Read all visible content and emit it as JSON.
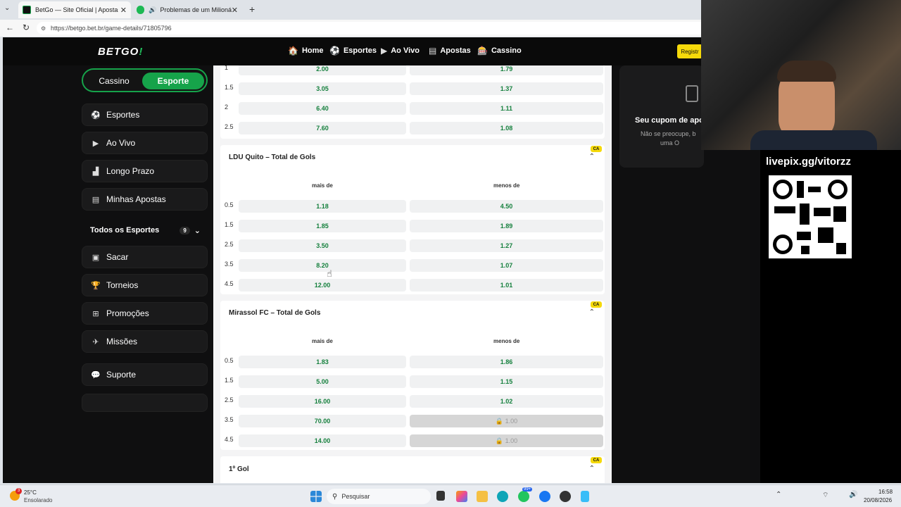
{
  "browser": {
    "tabs": [
      {
        "title": "BetGo — Site Oficial | Apostas Esp"
      },
      {
        "title": "Problemas de um Milionário -"
      }
    ],
    "new_tab": "+",
    "url": "https://betgo.bet.br/game-details/71805796"
  },
  "site": {
    "logo_main": "BETGO",
    "logo_accent": "!",
    "nav": [
      {
        "label": "Home",
        "icon": "🏠"
      },
      {
        "label": "Esportes",
        "icon": "⚽"
      },
      {
        "label": "Ao Vivo",
        "icon": "▶"
      },
      {
        "label": "Apostas",
        "icon": "▤"
      },
      {
        "label": "Cassino",
        "icon": "🎰"
      }
    ],
    "register": "Registr"
  },
  "sidebar": {
    "toggle": {
      "casino": "Cassino",
      "sport": "Esporte"
    },
    "items_top": [
      {
        "label": "Esportes",
        "icon": "⚽"
      },
      {
        "label": "Ao Vivo",
        "icon": "▶"
      },
      {
        "label": "Longo Prazo",
        "icon": "▟"
      },
      {
        "label": "Minhas Apostas",
        "icon": "▤"
      }
    ],
    "all_sports": {
      "label": "Todos os Esportes",
      "count": "9",
      "chevron": "⌄"
    },
    "items_bottom": [
      {
        "label": "Sacar",
        "icon": "▣"
      },
      {
        "label": "Torneios",
        "icon": "🏆"
      },
      {
        "label": "Promoções",
        "icon": "⊞"
      },
      {
        "label": "Missões",
        "icon": "✈"
      }
    ],
    "support": {
      "label": "Suporte",
      "icon": "💬"
    }
  },
  "markets": {
    "top_partial": [
      {
        "line": "1",
        "over": "2.00",
        "under": "1.79"
      },
      {
        "line": "1.5",
        "over": "3.05",
        "under": "1.37"
      },
      {
        "line": "2",
        "over": "6.40",
        "under": "1.11"
      },
      {
        "line": "2.5",
        "over": "7.60",
        "under": "1.08"
      }
    ],
    "ldu": {
      "title": "LDU Quito – Total de Gols",
      "ca": "CA",
      "col_over": "mais de",
      "col_under": "menos de",
      "rows": [
        {
          "line": "0.5",
          "over": "1.18",
          "under": "4.50"
        },
        {
          "line": "1.5",
          "over": "1.85",
          "under": "1.89"
        },
        {
          "line": "2.5",
          "over": "3.50",
          "under": "1.27"
        },
        {
          "line": "3.5",
          "over": "8.20",
          "under": "1.07"
        },
        {
          "line": "4.5",
          "over": "12.00",
          "under": "1.01"
        }
      ]
    },
    "mirassol": {
      "title": "Mirassol FC – Total de Gols",
      "ca": "CA",
      "col_over": "mais de",
      "col_under": "menos de",
      "rows": [
        {
          "line": "0.5",
          "over": "1.83",
          "under": "1.86"
        },
        {
          "line": "1.5",
          "over": "5.00",
          "under": "1.15"
        },
        {
          "line": "2.5",
          "over": "16.00",
          "under": "1.02"
        },
        {
          "line": "3.5",
          "over": "70.00",
          "under": "🔒 1.00"
        },
        {
          "line": "4.5",
          "over": "14.00",
          "under": "🔒 1.00"
        }
      ]
    },
    "first_goal": {
      "title": "1º Gol",
      "ca": "CA"
    }
  },
  "coupon": {
    "title": "Seu cupom de apo",
    "text1": "Não se preocupe, b",
    "text2": "uma O"
  },
  "overlay": {
    "livepix": "livepix.gg/vitorzz"
  },
  "taskbar": {
    "weather_temp": "25°C",
    "weather_desc": "Ensolarado",
    "weather_badge": "3",
    "search": "Pesquisar",
    "mail_badge": "99+",
    "time": "16:58",
    "date": "20/08/2026"
  },
  "colors": {
    "brand_green": "#16a34a",
    "odd_green": "#15803d",
    "badge_yellow": "#f5d90a"
  }
}
